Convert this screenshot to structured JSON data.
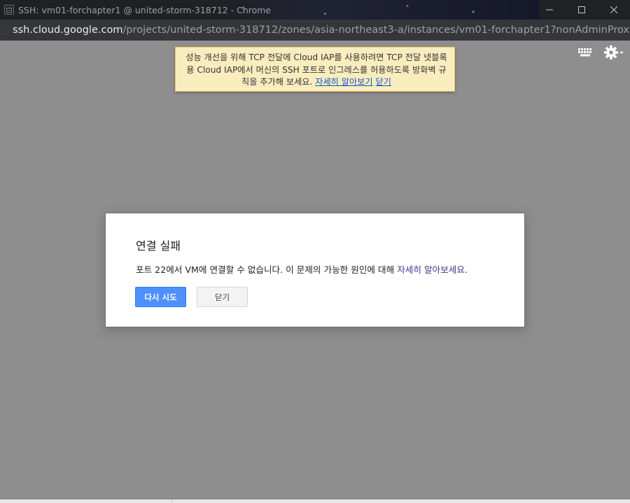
{
  "window": {
    "title": "SSH: vm01-forchapter1 @ united-storm-318712 - Chrome",
    "app_icon": "terminal-icon"
  },
  "address": {
    "host": "ssh.cloud.google.com",
    "path": "/projects/united-storm-318712/zones/asia-northeast3-a/instances/vm01-forchapter1?nonAdminProxySessionR..."
  },
  "banner": {
    "text": "성능 개선을 위해 TCP 전달에 Cloud IAP를 사용하려면 TCP 전달 넷블록용 Cloud IAP에서 머신의 SSH 포트로 인그레스를 허용하도록 방화벽 규칙을 추가해 보세요.",
    "learn_more": "자세히 알아보기",
    "close": "닫기"
  },
  "dialog": {
    "title": "연결 실패",
    "message": "포트 22에서 VM에 연결할 수 없습니다. 이 문제의 가능한 원인에 대해 ",
    "message_link": "자세히 알아보세요",
    "message_end": ".",
    "retry_label": "다시 시도",
    "close_label": "닫기"
  },
  "colors": {
    "background": "#8e8e8e",
    "primary_button": "#4d90fe",
    "banner": "#f9edbe"
  }
}
